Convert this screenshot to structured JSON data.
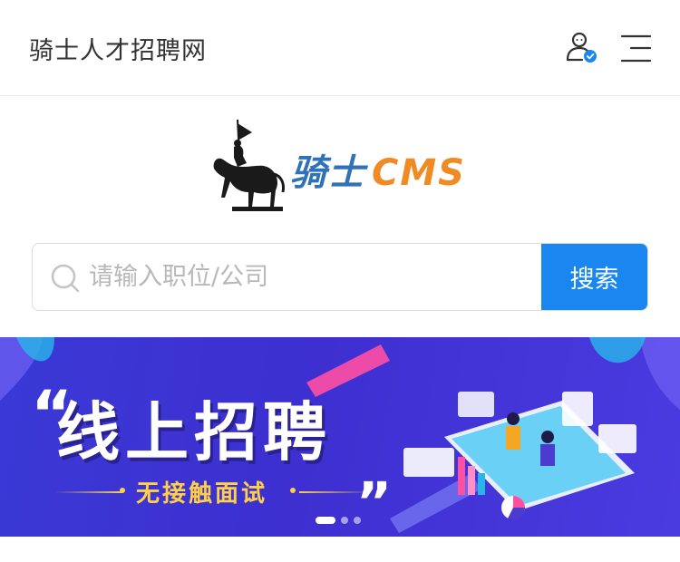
{
  "header": {
    "site_title": "骑士人才招聘网",
    "user_icon": "user-verified-icon",
    "menu_icon": "hamburger-menu-icon"
  },
  "logo": {
    "text_main": "骑士",
    "text_brand": "CMS",
    "emblem": "knight-on-horse-icon"
  },
  "search": {
    "placeholder": "请输入职位/公司",
    "value": "",
    "button_label": "搜索",
    "icon": "search-icon"
  },
  "banner": {
    "headline": "线上招聘",
    "open_quote": "“",
    "close_quote": "„",
    "subtitle": "无接触面试",
    "slides_total": 3,
    "active_slide": 1
  },
  "colors": {
    "accent": "#1a86f0",
    "banner_bg": "#3d2fd0",
    "subtitle": "#ffcf48",
    "logo_blue": "#2f72b8",
    "logo_orange": "#f08a24"
  }
}
